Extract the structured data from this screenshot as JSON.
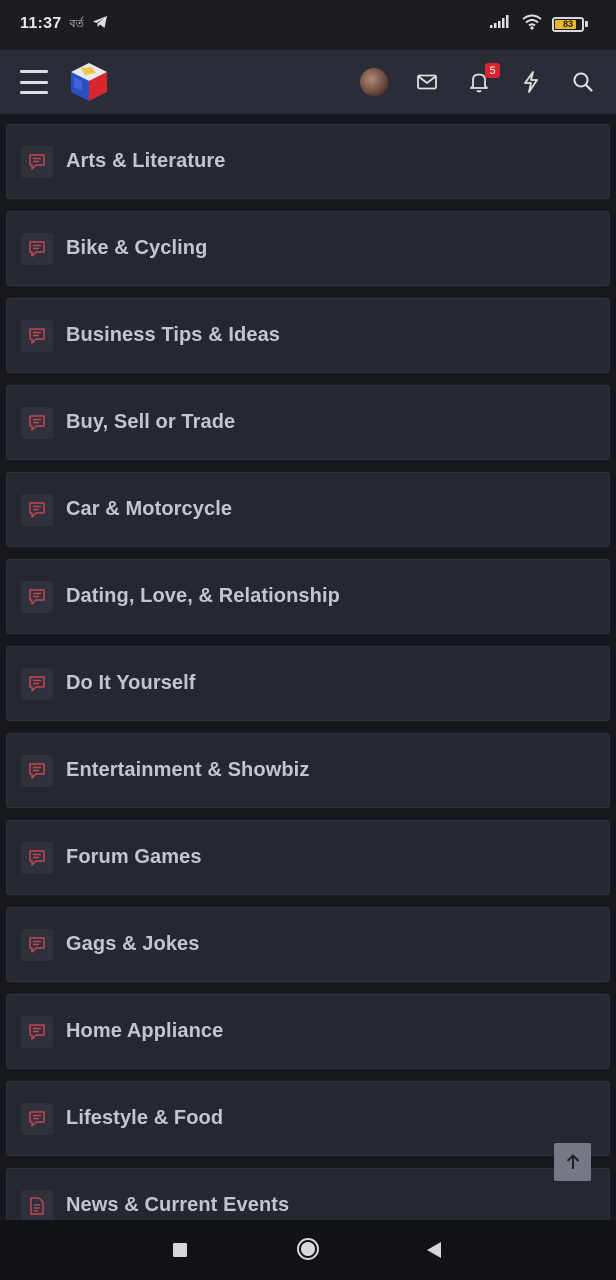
{
  "status_bar": {
    "time": "11:37",
    "carrier_glyph": "বর্ত",
    "battery_level": 0.83,
    "battery_text": "83"
  },
  "header": {
    "notification_count": "5",
    "icons": [
      "menu-icon",
      "logo",
      "avatar",
      "envelope-icon",
      "bell-icon",
      "bolt-icon",
      "search-icon"
    ]
  },
  "forums": [
    {
      "label": "Arts & Literature",
      "icon": "chat-bubble-icon"
    },
    {
      "label": "Bike & Cycling",
      "icon": "chat-bubble-icon"
    },
    {
      "label": "Business Tips & Ideas",
      "icon": "chat-bubble-icon"
    },
    {
      "label": "Buy, Sell or Trade",
      "icon": "chat-bubble-icon"
    },
    {
      "label": "Car & Motorcycle",
      "icon": "chat-bubble-icon"
    },
    {
      "label": "Dating, Love, & Relationship",
      "icon": "chat-bubble-icon"
    },
    {
      "label": "Do It Yourself",
      "icon": "chat-bubble-icon"
    },
    {
      "label": "Entertainment & Showbiz",
      "icon": "chat-bubble-icon"
    },
    {
      "label": "Forum Games",
      "icon": "chat-bubble-icon"
    },
    {
      "label": "Gags & Jokes",
      "icon": "chat-bubble-icon"
    },
    {
      "label": "Home Appliance",
      "icon": "chat-bubble-icon"
    },
    {
      "label": "Lifestyle & Food",
      "icon": "chat-bubble-icon"
    },
    {
      "label": "News & Current Events",
      "icon": "document-icon"
    }
  ],
  "colors": {
    "accent": "#c4464e",
    "background": "#17181d",
    "item_background": "#252830",
    "header_background": "#2a2d38"
  }
}
